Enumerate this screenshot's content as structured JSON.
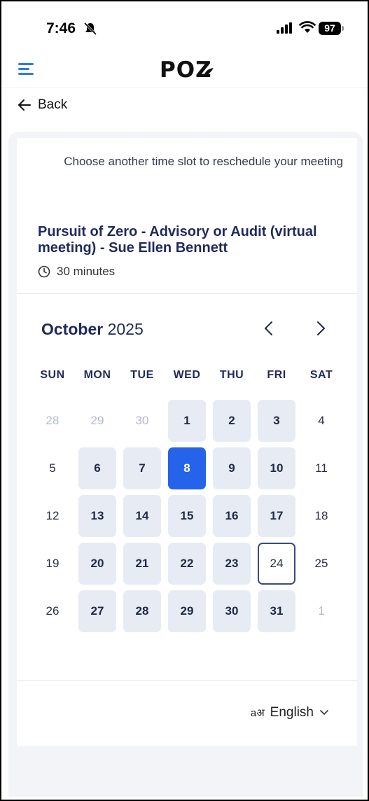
{
  "status_bar": {
    "time": "7:46",
    "battery": "97"
  },
  "header": {
    "logo": "POZ"
  },
  "back": {
    "label": "Back"
  },
  "intro": {
    "text": "Choose another time slot to reschedule your meeting"
  },
  "event": {
    "title": "Pursuit of Zero - Advisory or Audit (virtual meeting) - Sue Ellen Bennett",
    "duration": "30 minutes"
  },
  "calendar": {
    "month": "October",
    "year": "2025",
    "weekdays": [
      "SUN",
      "MON",
      "TUE",
      "WED",
      "THU",
      "FRI",
      "SAT"
    ],
    "days": [
      {
        "d": "28",
        "s": "muted"
      },
      {
        "d": "29",
        "s": "muted"
      },
      {
        "d": "30",
        "s": "muted"
      },
      {
        "d": "1",
        "s": "avail"
      },
      {
        "d": "2",
        "s": "avail"
      },
      {
        "d": "3",
        "s": "avail"
      },
      {
        "d": "4",
        "s": "plain"
      },
      {
        "d": "5",
        "s": "plain"
      },
      {
        "d": "6",
        "s": "avail"
      },
      {
        "d": "7",
        "s": "avail"
      },
      {
        "d": "8",
        "s": "selected"
      },
      {
        "d": "9",
        "s": "avail"
      },
      {
        "d": "10",
        "s": "avail"
      },
      {
        "d": "11",
        "s": "plain"
      },
      {
        "d": "12",
        "s": "plain"
      },
      {
        "d": "13",
        "s": "avail"
      },
      {
        "d": "14",
        "s": "avail"
      },
      {
        "d": "15",
        "s": "avail"
      },
      {
        "d": "16",
        "s": "avail"
      },
      {
        "d": "17",
        "s": "avail"
      },
      {
        "d": "18",
        "s": "plain"
      },
      {
        "d": "19",
        "s": "plain"
      },
      {
        "d": "20",
        "s": "avail"
      },
      {
        "d": "21",
        "s": "avail"
      },
      {
        "d": "22",
        "s": "avail"
      },
      {
        "d": "23",
        "s": "avail"
      },
      {
        "d": "24",
        "s": "today"
      },
      {
        "d": "25",
        "s": "plain"
      },
      {
        "d": "26",
        "s": "plain"
      },
      {
        "d": "27",
        "s": "avail"
      },
      {
        "d": "28",
        "s": "avail"
      },
      {
        "d": "29",
        "s": "avail"
      },
      {
        "d": "30",
        "s": "avail"
      },
      {
        "d": "31",
        "s": "avail"
      },
      {
        "d": "1",
        "s": "muted"
      }
    ]
  },
  "language": {
    "glyph": "aअ",
    "label": "English"
  },
  "colors": {
    "accent": "#2563eb",
    "available": "#e7ebf4",
    "title": "#1f2a5c",
    "menu": "#2f7de1"
  },
  "icons": [
    "bell-slash-icon",
    "signal-icon",
    "wifi-icon",
    "battery-icon",
    "menu-icon",
    "back-arrow-icon",
    "clock-icon",
    "chevron-left-icon",
    "chevron-right-icon",
    "chevron-down-icon"
  ]
}
